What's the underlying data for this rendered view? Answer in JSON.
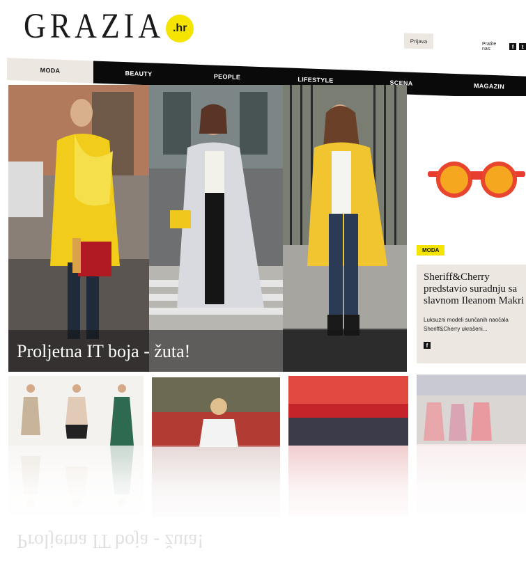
{
  "header": {
    "logo_text": "GRAZIA",
    "logo_badge": ".hr",
    "login_label": "Prijava",
    "follow_label": "Pratite nas:",
    "social": [
      "facebook-icon",
      "twitter-icon"
    ]
  },
  "nav": {
    "items": [
      {
        "label": "MODA",
        "active": true
      },
      {
        "label": "BEAUTY",
        "active": false
      },
      {
        "label": "PEOPLE",
        "active": false
      },
      {
        "label": "LIFESTYLE",
        "active": false
      },
      {
        "label": "SCENA",
        "active": false
      },
      {
        "label": "MAGAZIN",
        "active": false
      }
    ]
  },
  "hero": {
    "caption": "Proljetna IT boja - žuta!"
  },
  "promo": {
    "tag": "MODA",
    "title": "Sheriff&Cherry predstavio suradnju sa slavnom Ileanom Makri",
    "text": "Luksuzni modeli sunčanih naočala Sheriff&Cherry ukrašeni..."
  },
  "colors": {
    "accent_yellow": "#f5e400",
    "nav_black": "#0a0a0a",
    "nav_active_bg": "#ece7e1"
  }
}
